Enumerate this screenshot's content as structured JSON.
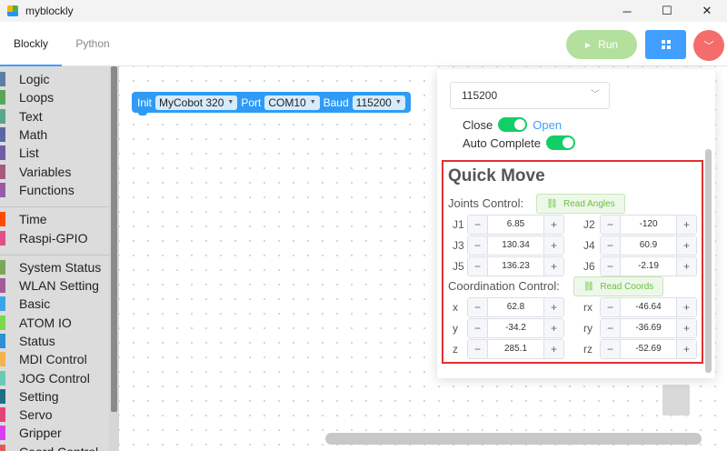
{
  "window": {
    "title": "myblockly",
    "minimize": "─",
    "maximize": "☐",
    "close": "✕"
  },
  "tabs": {
    "blockly": "Blockly",
    "python": "Python"
  },
  "toolbar": {
    "run_label": "Run",
    "run_icon": "▶",
    "menu_icon": "﹀"
  },
  "toolbox": {
    "groups": [
      [
        {
          "label": "Logic",
          "color": "#5b80a5"
        },
        {
          "label": "Loops",
          "color": "#5ba55b"
        },
        {
          "label": "Text",
          "color": "#5ba58c"
        },
        {
          "label": "Math",
          "color": "#5b67a5"
        },
        {
          "label": "List",
          "color": "#745ba5"
        },
        {
          "label": "Variables",
          "color": "#a55b80"
        },
        {
          "label": "Functions",
          "color": "#995ba5"
        }
      ],
      [
        {
          "label": "Time",
          "color": "#ff4d00"
        },
        {
          "label": "Raspi-GPIO",
          "color": "#e0508a"
        }
      ],
      [
        {
          "label": "System Status",
          "color": "#7ea65b"
        },
        {
          "label": "WLAN Setting",
          "color": "#a55b99"
        },
        {
          "label": "Basic",
          "color": "#3da3e8"
        },
        {
          "label": "ATOM IO",
          "color": "#7ad94a"
        },
        {
          "label": "Status",
          "color": "#2d8fd5"
        },
        {
          "label": "MDI Control",
          "color": "#f2b24c"
        },
        {
          "label": "JOG Control",
          "color": "#6bc9b8"
        },
        {
          "label": "Setting",
          "color": "#1e6f86"
        },
        {
          "label": "Servo",
          "color": "#e7417a"
        },
        {
          "label": "Gripper",
          "color": "#d93df2"
        },
        {
          "label": "Coord Control",
          "color": "#e05b5b"
        }
      ]
    ]
  },
  "block": {
    "init": "Init",
    "robot": "MyCobot 320",
    "port_label": "Port",
    "port": "COM10",
    "baud_label": "Baud",
    "baud": "115200"
  },
  "panel": {
    "baud_select": "115200",
    "close_label": "Close",
    "open_label": "Open",
    "auto_complete_label": "Auto Complete",
    "quick_move_title": "Quick Move",
    "joints_control_label": "Joints Control:",
    "read_angles": "Read Angles",
    "coordination_control_label": "Coordination Control:",
    "read_coords": "Read Coords",
    "joints": [
      {
        "label": "J1",
        "value": "6.85"
      },
      {
        "label": "J2",
        "value": "-120"
      },
      {
        "label": "J3",
        "value": "130.34"
      },
      {
        "label": "J4",
        "value": "60.9"
      },
      {
        "label": "J5",
        "value": "136.23"
      },
      {
        "label": "J6",
        "value": "-2.19"
      }
    ],
    "coords": [
      {
        "label": "x",
        "value": "62.8"
      },
      {
        "label": "rx",
        "value": "-46.64"
      },
      {
        "label": "y",
        "value": "-34.2"
      },
      {
        "label": "ry",
        "value": "-36.69"
      },
      {
        "label": "z",
        "value": "285.1"
      },
      {
        "label": "rz",
        "value": "-52.69"
      }
    ],
    "minus": "−",
    "plus": "+"
  }
}
